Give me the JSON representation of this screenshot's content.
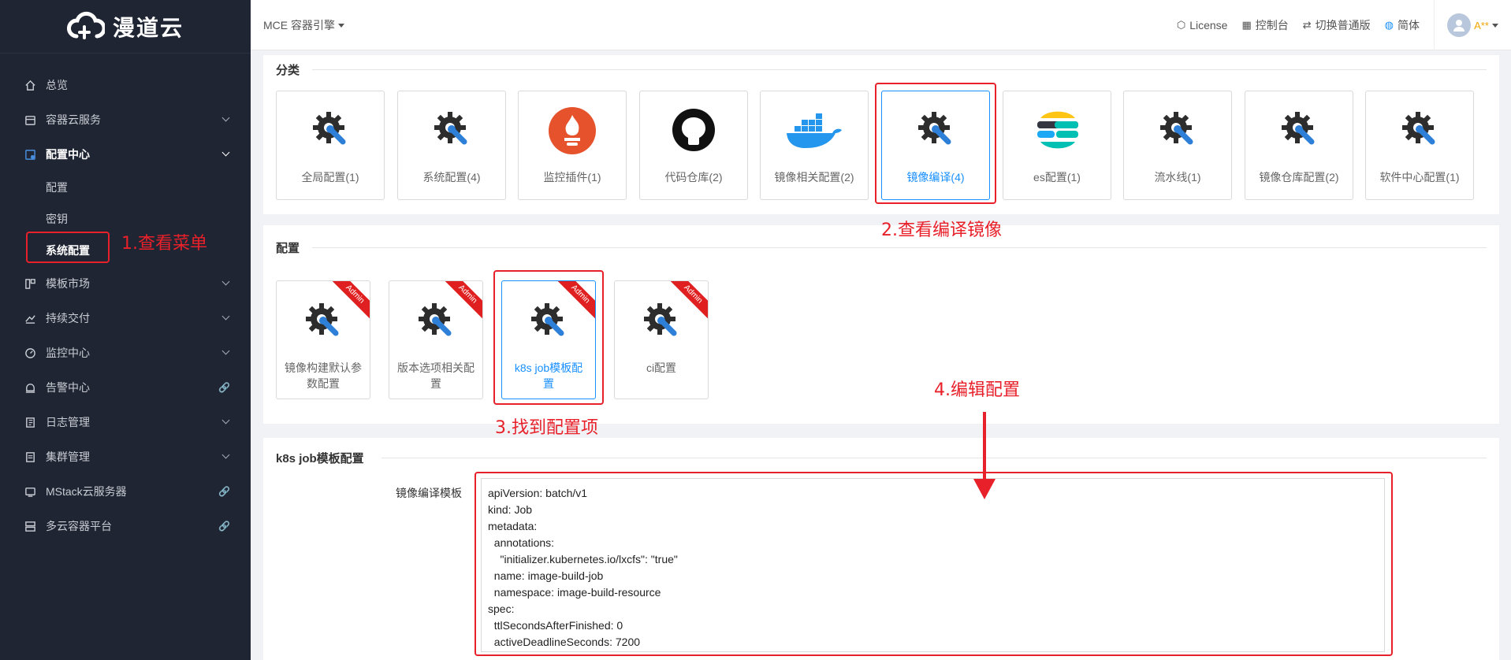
{
  "app": {
    "logo_text": "漫道云"
  },
  "sidebar": {
    "items": [
      {
        "label": "总览",
        "icon": "home-icon",
        "expandable": false,
        "link": false
      },
      {
        "label": "容器云服务",
        "icon": "box-icon",
        "expandable": true,
        "link": false
      },
      {
        "label": "配置中心",
        "icon": "config-icon",
        "expandable": true,
        "link": false,
        "active": true
      },
      {
        "label": "模板市场",
        "icon": "template-icon",
        "expandable": true,
        "link": false
      },
      {
        "label": "持续交付",
        "icon": "delivery-icon",
        "expandable": true,
        "link": false
      },
      {
        "label": "监控中心",
        "icon": "monitor-icon",
        "expandable": true,
        "link": false
      },
      {
        "label": "告警中心",
        "icon": "alarm-icon",
        "expandable": false,
        "link": true
      },
      {
        "label": "日志管理",
        "icon": "log-icon",
        "expandable": true,
        "link": false
      },
      {
        "label": "集群管理",
        "icon": "cluster-icon",
        "expandable": true,
        "link": false
      },
      {
        "label": "MStack云服务器",
        "icon": "server-icon",
        "expandable": false,
        "link": true
      },
      {
        "label": "多云容器平台",
        "icon": "cloud-platform-icon",
        "expandable": false,
        "link": true
      }
    ],
    "sub_items": [
      "配置",
      "密钥",
      "系统配置"
    ]
  },
  "header": {
    "product": "MCE 容器引擎",
    "links": [
      {
        "label": "License",
        "icon": "cube-icon"
      },
      {
        "label": "控制台",
        "icon": "grid-icon"
      },
      {
        "label": "切换普通版",
        "icon": "switch-icon"
      },
      {
        "label": "简体",
        "icon": "globe-icon"
      }
    ],
    "user": "A**"
  },
  "categories": {
    "title": "分类",
    "cards": [
      {
        "label": "全局配置(1)",
        "icon": "gear-wrench-icon"
      },
      {
        "label": "系统配置(4)",
        "icon": "gear-wrench-icon"
      },
      {
        "label": "监控插件(1)",
        "icon": "prometheus-icon"
      },
      {
        "label": "代码仓库(2)",
        "icon": "github-icon"
      },
      {
        "label": "镜像相关配置(2)",
        "icon": "docker-icon"
      },
      {
        "label": "镜像编译(4)",
        "icon": "gear-wrench-icon",
        "selected": true
      },
      {
        "label": "es配置(1)",
        "icon": "elastic-icon"
      },
      {
        "label": "流水线(1)",
        "icon": "gear-wrench-icon"
      },
      {
        "label": "镜像仓库配置(2)",
        "icon": "gear-wrench-icon"
      },
      {
        "label": "软件中心配置(1)",
        "icon": "gear-wrench-icon"
      }
    ]
  },
  "configs": {
    "title": "配置",
    "ribbon": "Admin",
    "cards": [
      {
        "label": "镜像构建默认参数配置",
        "icon": "gear-wrench-icon"
      },
      {
        "label": "版本选项相关配置",
        "icon": "gear-wrench-icon"
      },
      {
        "label": "k8s job模板配置",
        "icon": "gear-wrench-icon",
        "selected": true
      },
      {
        "label": "ci配置",
        "icon": "gear-wrench-icon"
      }
    ]
  },
  "detail": {
    "title": "k8s job模板配置",
    "field_label": "镜像编译模板",
    "template_value": "apiVersion: batch/v1\nkind: Job\nmetadata:\n  annotations:\n    \"initializer.kubernetes.io/lxcfs\": \"true\"\n  name: image-build-job\n  namespace: image-build-resource\nspec:\n  ttlSecondsAfterFinished: 0\n  activeDeadlineSeconds: 7200"
  },
  "annotations": {
    "step1": "1.查看菜单",
    "step2": "2.查看编译镜像",
    "step3": "3.找到配置项",
    "step4": "4.编辑配置"
  },
  "colors": {
    "sidebar_bg": "#1f2533",
    "accent": "#1890ff",
    "annotation": "#e8202a",
    "ribbon": "#e02020"
  }
}
